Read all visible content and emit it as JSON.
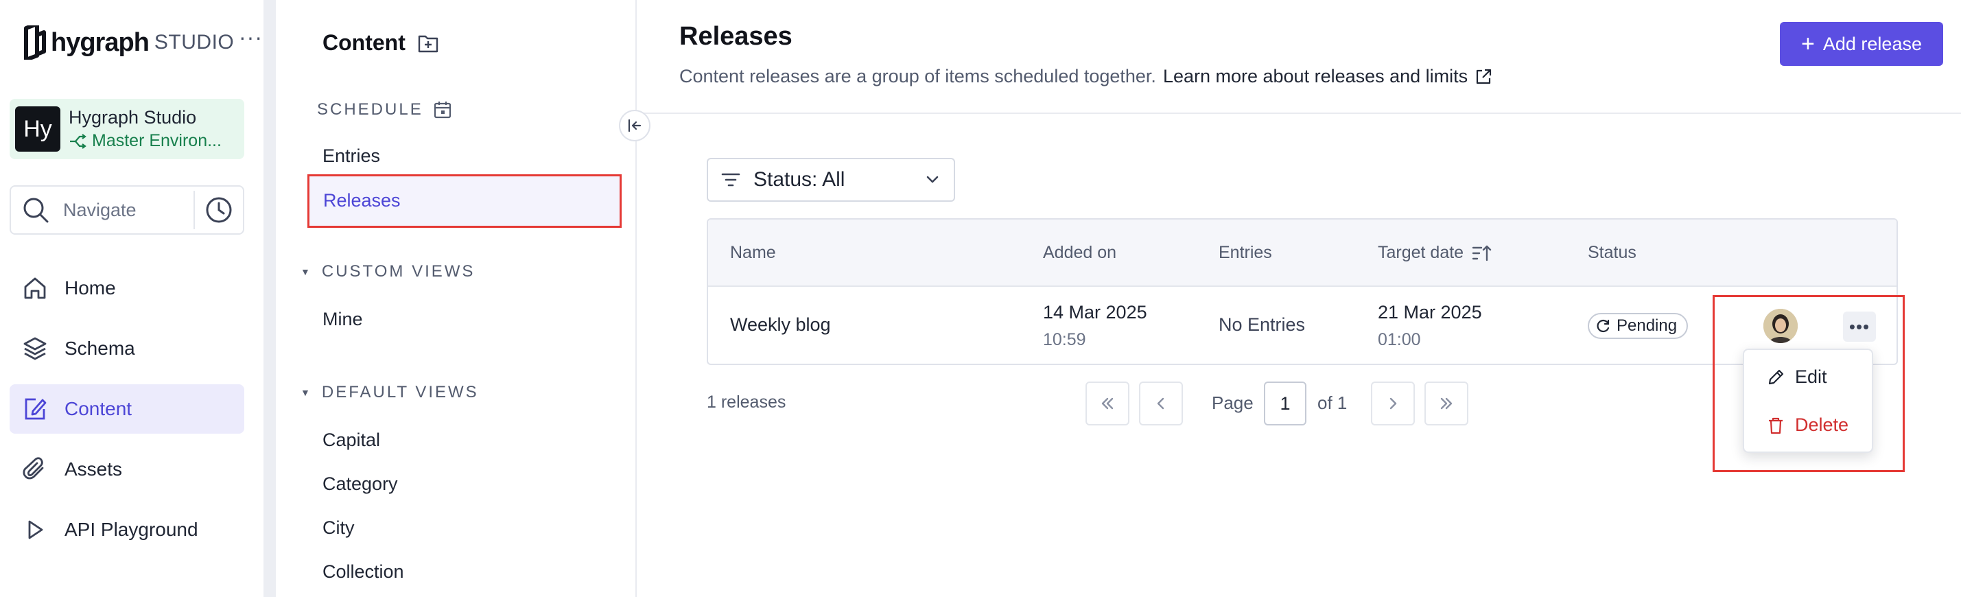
{
  "brand": {
    "name": "hygraph",
    "suffix": "STUDIO",
    "more": "···"
  },
  "project": {
    "avatar": "Hy",
    "name": "Hygraph Studio",
    "environment": "Master Environ..."
  },
  "navigate": {
    "label": "Navigate"
  },
  "nav": [
    {
      "label": "Home",
      "icon": "home-icon"
    },
    {
      "label": "Schema",
      "icon": "layers-icon"
    },
    {
      "label": "Content",
      "icon": "edit-icon",
      "active": true
    },
    {
      "label": "Assets",
      "icon": "paperclip-icon"
    },
    {
      "label": "API Playground",
      "icon": "play-icon"
    }
  ],
  "content_sidebar": {
    "title": "Content",
    "schedule": {
      "heading": "SCHEDULE",
      "items": [
        "Entries",
        "Releases"
      ]
    },
    "custom_views": {
      "heading": "CUSTOM VIEWS",
      "items": [
        "Mine"
      ]
    },
    "default_views": {
      "heading": "DEFAULT VIEWS",
      "items": [
        "Capital",
        "Category",
        "City",
        "Collection"
      ]
    }
  },
  "main": {
    "title": "Releases",
    "description": "Content releases are a group of items scheduled together.",
    "learn_more": "Learn more about releases and limits",
    "add_button": "Add release",
    "filter_label": "Status: All",
    "columns": {
      "name": "Name",
      "added_on": "Added on",
      "entries": "Entries",
      "target_date": "Target date",
      "status": "Status"
    },
    "rows": [
      {
        "name": "Weekly blog",
        "added_date": "14 Mar 2025",
        "added_time": "10:59",
        "entries": "No Entries",
        "target_date": "21 Mar 2025",
        "target_time": "01:00",
        "status": "Pending"
      }
    ],
    "count": "1 releases",
    "pagination": {
      "page_label": "Page",
      "current": "1",
      "of_label": "of 1"
    },
    "row_menu": {
      "edit": "Edit",
      "delete": "Delete"
    }
  },
  "colors": {
    "accent": "#5b4ee2",
    "active_nav_bg": "#ecebfc",
    "delete": "#d12f2f",
    "env_green": "#18804d",
    "highlight": "#e53935"
  }
}
